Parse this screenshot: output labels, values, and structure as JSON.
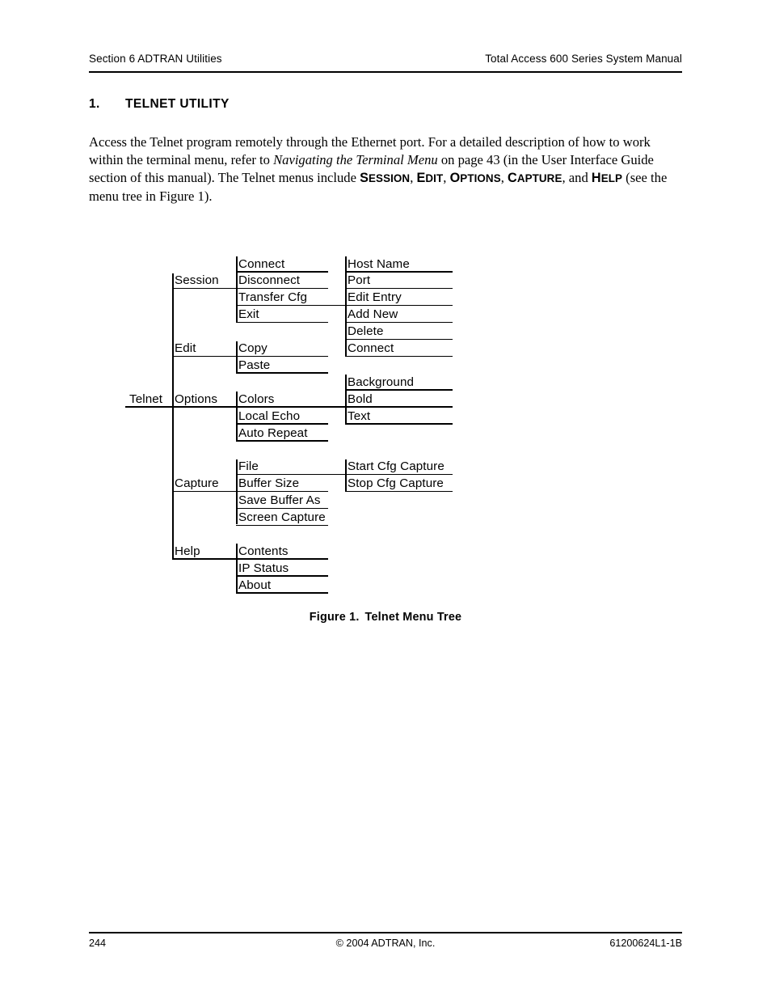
{
  "page": {
    "header_left": "Section 6  ADTRAN Utilities",
    "header_right": "Total Access 600 Series System Manual",
    "footer_page_number": "244",
    "footer_copyright": "© 2004 ADTRAN, Inc.",
    "footer_doc_number": "61200624L1-1B"
  },
  "section": {
    "number": "1.",
    "title": "TELNET UTILITY"
  },
  "body": {
    "part1": "Access the Telnet program remotely through the Ethernet port. For a detailed description of how to work within the terminal menu, refer to ",
    "italic_title": "Navigating the Terminal Menu",
    "part2": " on page 43 (in the User Interface Guide section of this manual). The Telnet menus include ",
    "menu_names": [
      "SESSION",
      "EDIT",
      "OPTIONS",
      "CAPTURE",
      "HELP"
    ],
    "part3": " (see the menu tree in Figure 1)."
  },
  "figure": {
    "caption_label": "Figure 1.",
    "caption_title": "Telnet Menu Tree",
    "root": "Telnet",
    "menus": [
      {
        "name": "Session",
        "items": [
          {
            "label": "Connect"
          },
          {
            "label": "Disconnect"
          },
          {
            "label": "Transfer Cfg",
            "children": [
              "Host Name",
              "Port",
              "Edit Entry",
              "Add New",
              "Delete",
              "Connect"
            ]
          },
          {
            "label": "Exit"
          }
        ]
      },
      {
        "name": "Edit",
        "items": [
          {
            "label": "Copy"
          },
          {
            "label": "Paste"
          }
        ]
      },
      {
        "name": "Options",
        "items": [
          {
            "label": "Colors",
            "children": [
              "Background",
              "Bold",
              "Text"
            ]
          },
          {
            "label": "Local Echo"
          },
          {
            "label": "Auto Repeat"
          }
        ]
      },
      {
        "name": "Capture",
        "items": [
          {
            "label": "File",
            "children": [
              "Start Cfg Capture",
              "Stop Cfg Capture"
            ]
          },
          {
            "label": "Buffer Size"
          },
          {
            "label": "Save Buffer As"
          },
          {
            "label": "Screen Capture"
          }
        ]
      },
      {
        "name": "Help",
        "items": [
          {
            "label": "Contents"
          },
          {
            "label": "IP Status"
          },
          {
            "label": "About"
          }
        ]
      }
    ]
  }
}
